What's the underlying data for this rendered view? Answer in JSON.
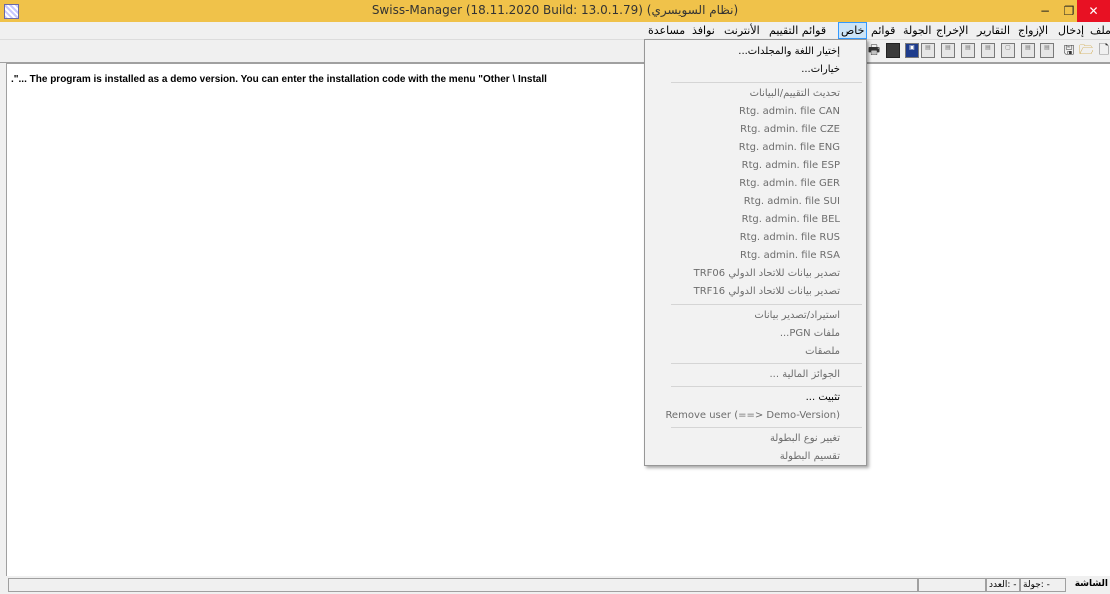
{
  "window": {
    "title": "Swiss-Manager (18.11.2020 Build: 13.0.1.79)      (نظام السويسري)",
    "min_glyph": "−",
    "max_glyph": "❐",
    "close_glyph": "✕"
  },
  "menubar": {
    "items": [
      "ملف",
      "إدخال",
      "الإزواج",
      "التقارير",
      "الإخراج",
      "الجولة",
      "قوائم",
      "خاص",
      "قوائم التقييم",
      "الأنترنت",
      "نوافذ",
      "مساعدة"
    ]
  },
  "toolbar": {
    "icons": [
      "new-file-icon",
      "open-folder-icon",
      "save-icon",
      "armenian-pairing-icon",
      "sp-icon",
      "page-icon",
      "sp-icon",
      "score-icon",
      "tur-icon",
      "rd-icon",
      "elo-icon",
      "screen-icon",
      "print-icon"
    ]
  },
  "workspace": {
    "demo_message": ".\"... The program is installed as a demo version. You can enter the installation code with the menu \"Other \\ Install"
  },
  "statusbar": {
    "screen_label": "الشاشة",
    "round_label": "جولة: -",
    "count_label": "العدد: -"
  },
  "dropdown": {
    "items": [
      {
        "label": "إختيار اللغة والمجلدات...",
        "enabled": true
      },
      {
        "label": "خيارات...",
        "enabled": true
      },
      {
        "label": "تحديث التقييم/البيانات",
        "enabled": false
      },
      {
        "label": "Rtg. admin. file CAN",
        "enabled": false
      },
      {
        "label": "Rtg. admin. file CZE",
        "enabled": false
      },
      {
        "label": "Rtg. admin. file ENG",
        "enabled": false
      },
      {
        "label": "Rtg. admin. file ESP",
        "enabled": false
      },
      {
        "label": "Rtg. admin. file GER",
        "enabled": false
      },
      {
        "label": "Rtg. admin. file SUI",
        "enabled": false
      },
      {
        "label": "Rtg. admin. file BEL",
        "enabled": false
      },
      {
        "label": "Rtg. admin. file RUS",
        "enabled": false
      },
      {
        "label": "Rtg. admin. file RSA",
        "enabled": false
      },
      {
        "label": "تصدير بيانات للاتحاد الدولي TRF06",
        "enabled": false
      },
      {
        "label": "تصدير بيانات للاتحاد الدولي TRF16",
        "enabled": false
      },
      {
        "label": "استيراد/تصدير بيانات",
        "enabled": false
      },
      {
        "label": "ملفات PGN...",
        "enabled": false
      },
      {
        "label": "ملصقات",
        "enabled": false
      },
      {
        "label": "الجوائز المالية ...",
        "enabled": false
      },
      {
        "label": "تثبيت ...",
        "enabled": true
      },
      {
        "label": "Remove user (==> Demo-Version)",
        "enabled": false
      },
      {
        "label": "تغيير نوع البطولة",
        "enabled": false
      },
      {
        "label": "تقسيم البطولة",
        "enabled": false
      }
    ]
  },
  "colors": {
    "titlebar": "#f0c24a",
    "close": "#e81123",
    "menu_highlight": "#cce4f7",
    "disabled_text": "#6d6d6d"
  }
}
